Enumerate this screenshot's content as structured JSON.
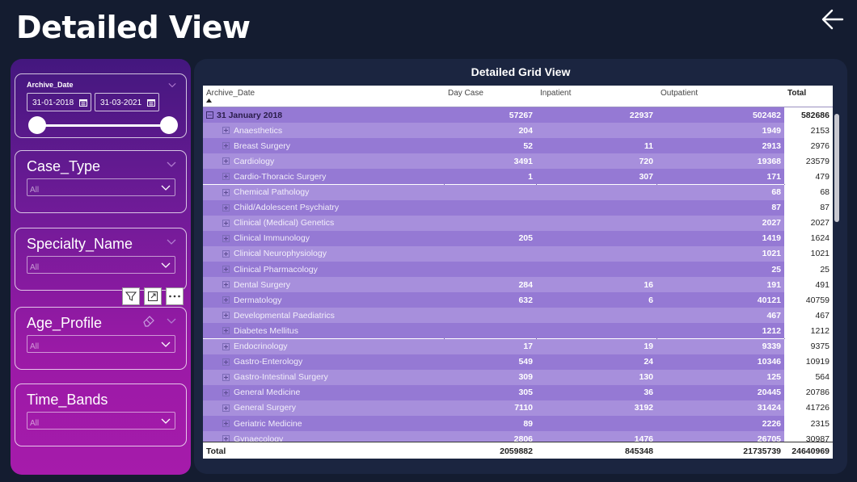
{
  "page": {
    "title": "Detailed View"
  },
  "nav": {
    "back_icon": "arrow-left-icon"
  },
  "filters": {
    "archive_date": {
      "label": "Archive_Date",
      "start": "31-01-2018",
      "end": "31-03-2021",
      "start_fraction": 0,
      "end_fraction": 1
    },
    "case_type": {
      "label": "Case_Type",
      "value": "All"
    },
    "specialty_name": {
      "label": "Specialty_Name",
      "value": "All"
    },
    "age_profile": {
      "label": "Age_Profile",
      "value": "All"
    },
    "time_bands": {
      "label": "Time_Bands",
      "value": "All"
    }
  },
  "toolbar": {
    "icons": [
      "filter-icon",
      "focus-mode-icon",
      "more-options-icon"
    ]
  },
  "grid": {
    "title": "Detailed Grid View",
    "columns": {
      "archive_date": "Archive_Date",
      "day_case": "Day Case",
      "inpatient": "Inpatient",
      "outpatient": "Outpatient",
      "total": "Total"
    },
    "group": {
      "label": "31 January 2018",
      "day_case": "57267",
      "inpatient": "22937",
      "outpatient": "502482",
      "total": "582686"
    },
    "rows": [
      {
        "name": "Anaesthetics",
        "day_case": "204",
        "inpatient": "",
        "outpatient": "1949",
        "total": "2153"
      },
      {
        "name": "Breast Surgery",
        "day_case": "52",
        "inpatient": "11",
        "outpatient": "2913",
        "total": "2976"
      },
      {
        "name": "Cardiology",
        "day_case": "3491",
        "inpatient": "720",
        "outpatient": "19368",
        "total": "23579"
      },
      {
        "name": "Cardio-Thoracic Surgery",
        "day_case": "1",
        "inpatient": "307",
        "outpatient": "171",
        "total": "479"
      },
      {
        "name": "Chemical Pathology",
        "day_case": "",
        "inpatient": "",
        "outpatient": "68",
        "total": "68"
      },
      {
        "name": "Child/Adolescent Psychiatry",
        "day_case": "",
        "inpatient": "",
        "outpatient": "87",
        "total": "87"
      },
      {
        "name": "Clinical (Medical) Genetics",
        "day_case": "",
        "inpatient": "",
        "outpatient": "2027",
        "total": "2027"
      },
      {
        "name": "Clinical Immunology",
        "day_case": "205",
        "inpatient": "",
        "outpatient": "1419",
        "total": "1624"
      },
      {
        "name": "Clinical Neurophysiology",
        "day_case": "",
        "inpatient": "",
        "outpatient": "1021",
        "total": "1021"
      },
      {
        "name": "Clinical Pharmacology",
        "day_case": "",
        "inpatient": "",
        "outpatient": "25",
        "total": "25"
      },
      {
        "name": "Dental Surgery",
        "day_case": "284",
        "inpatient": "16",
        "outpatient": "191",
        "total": "491"
      },
      {
        "name": "Dermatology",
        "day_case": "632",
        "inpatient": "6",
        "outpatient": "40121",
        "total": "40759"
      },
      {
        "name": "Developmental Paediatrics",
        "day_case": "",
        "inpatient": "",
        "outpatient": "467",
        "total": "467"
      },
      {
        "name": "Diabetes Mellitus",
        "day_case": "",
        "inpatient": "",
        "outpatient": "1212",
        "total": "1212"
      },
      {
        "name": "Endocrinology",
        "day_case": "17",
        "inpatient": "19",
        "outpatient": "9339",
        "total": "9375"
      },
      {
        "name": "Gastro-Enterology",
        "day_case": "549",
        "inpatient": "24",
        "outpatient": "10346",
        "total": "10919"
      },
      {
        "name": "Gastro-Intestinal Surgery",
        "day_case": "309",
        "inpatient": "130",
        "outpatient": "125",
        "total": "564"
      },
      {
        "name": "General Medicine",
        "day_case": "305",
        "inpatient": "36",
        "outpatient": "20445",
        "total": "20786"
      },
      {
        "name": "General Surgery",
        "day_case": "7110",
        "inpatient": "3192",
        "outpatient": "31424",
        "total": "41726"
      },
      {
        "name": "Geriatric Medicine",
        "day_case": "89",
        "inpatient": "",
        "outpatient": "2226",
        "total": "2315"
      },
      {
        "name": "Gynaecology",
        "day_case": "2806",
        "inpatient": "1476",
        "outpatient": "26705",
        "total": "30987"
      }
    ],
    "total": {
      "label": "Total",
      "day_case": "2059882",
      "inpatient": "845348",
      "outpatient": "21735739",
      "total": "24640969"
    }
  }
}
